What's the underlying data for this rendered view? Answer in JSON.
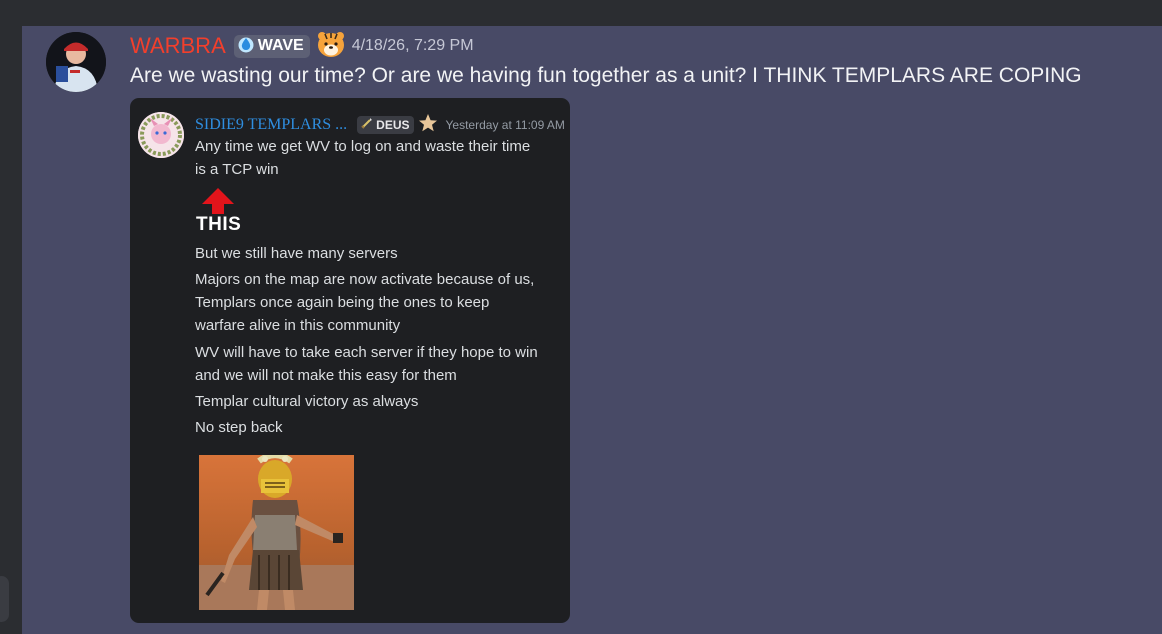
{
  "message": {
    "username": "WARBRA",
    "tag": {
      "label": "WAVE",
      "icon": "water-drop-icon"
    },
    "reaction_emoji": "tiger-face-icon",
    "timestamp": "4/18/26, 7:29 PM",
    "text": "Are we wasting our time? Or are we having fun together as a unit? I THINK TEMPLARS ARE COPING"
  },
  "embed": {
    "author": "SIDIE9 TEMPLARS ...",
    "badge": {
      "label": "DEUS",
      "icon": "sword-icon"
    },
    "badge_emoji": "star-icon",
    "timestamp": "Yesterday at 11:09 AM",
    "lines": [
      "Any time we get WV to log on and waste their time",
      "is a TCP win",
      "But we still have many servers",
      "Majors on the map are now activate because of us,",
      "Templars once again being the ones to keep",
      "warfare alive in this community",
      "WV will have to take each server if they hope to win",
      "and we will not make this easy for them",
      "Templar cultural victory as always",
      "No step back"
    ],
    "sticker_text": "THIS",
    "image_icon": "gladiator-image"
  },
  "colors": {
    "username": "#f23f2c",
    "embed_author": "#2f8ee0",
    "background": "#484a66",
    "embed_bg": "#1e1f22"
  }
}
